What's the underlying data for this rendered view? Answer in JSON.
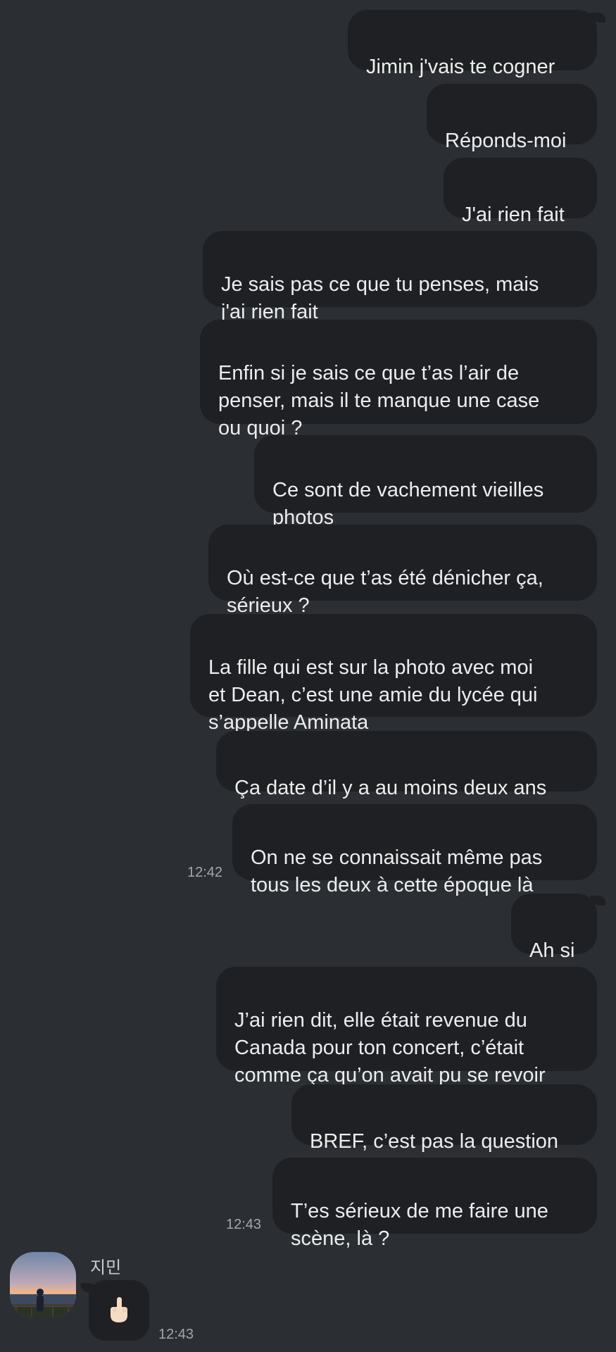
{
  "messages_sent": [
    {
      "text": "Jimin j'vais te cogner"
    },
    {
      "text": "Réponds-moi"
    },
    {
      "text": "J'ai rien fait"
    },
    {
      "text": "Je sais pas ce que tu penses, mais\nj'ai rien fait"
    },
    {
      "text": "Enfin si je sais ce que t’as l’air de\npenser, mais il te manque une case\nou quoi ?"
    },
    {
      "text": "Ce sont de vachement vieilles\nphotos"
    },
    {
      "text": "Où est-ce que t’as été dénicher ça,\nsérieux ?"
    },
    {
      "text": "La fille qui est sur la photo avec moi\net Dean, c’est une amie du lycée qui\ns’appelle Aminata"
    },
    {
      "text": "Ça date d’il y a au moins deux ans"
    },
    {
      "text": "On ne se connaissait même pas\ntous les deux à cette époque là"
    },
    {
      "text": "Ah si"
    },
    {
      "text": "J’ai rien dit, elle était revenue du\nCanada pour ton concert, c’était\ncomme ça qu’on avait pu se revoir"
    },
    {
      "text": "BREF, c’est pas la question"
    },
    {
      "text": "T’es sérieux de me faire une\nscène, là ?"
    }
  ],
  "timestamps": {
    "first_group": "12:42",
    "second_group": "12:43",
    "received": "12:43"
  },
  "contact": {
    "name": "지민",
    "avatar_icon": "sunset-ocean-avatar"
  },
  "received_message": {
    "emoji_icon": "middle-finger-emoji"
  },
  "colors": {
    "background": "#2b2e33",
    "bubble": "#1e2024",
    "text": "#eceded",
    "timestamp": "#a3a6ab"
  }
}
